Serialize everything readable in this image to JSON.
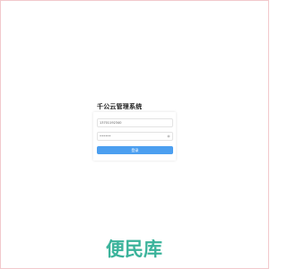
{
  "app": {
    "title": "千公云管理系统"
  },
  "login": {
    "username_value": "13701192340",
    "password_value": "••••••",
    "submit_label": "登录"
  },
  "watermark": {
    "text": "便民库"
  },
  "colors": {
    "accent": "#4c9ff0",
    "watermark": "#3bb39b",
    "border": "#f2c9cc"
  }
}
